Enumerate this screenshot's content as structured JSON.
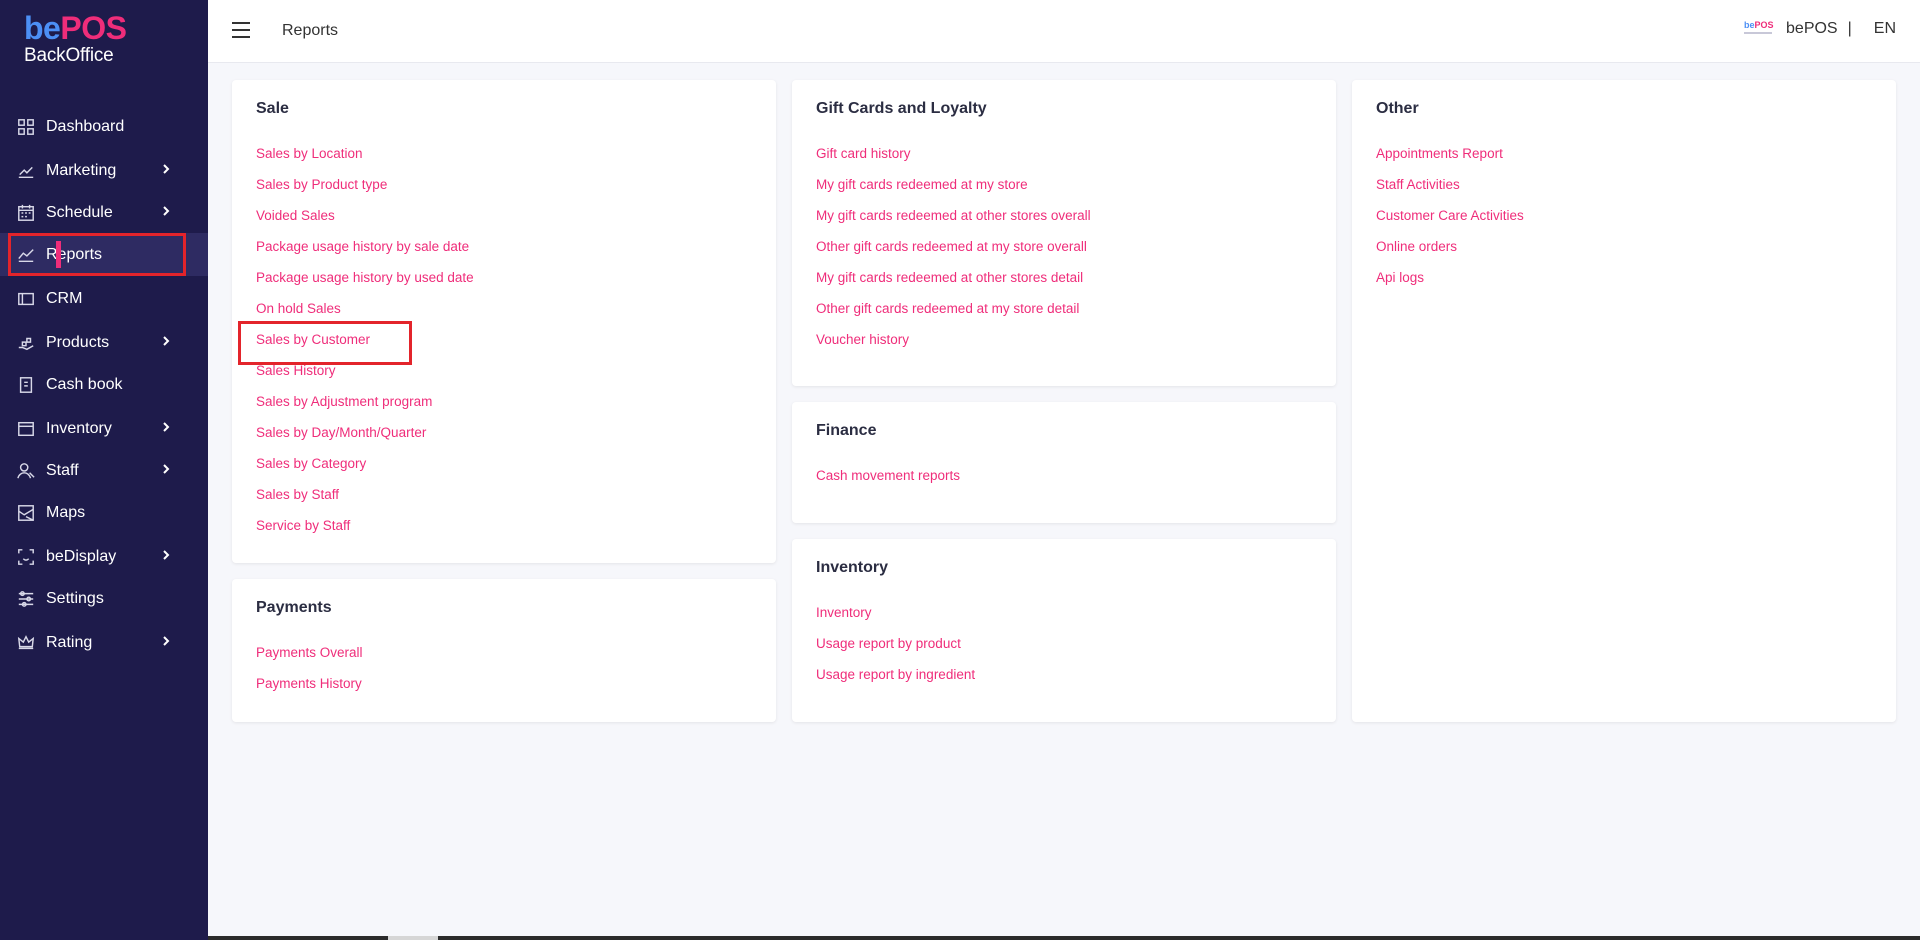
{
  "app": {
    "brand_be": "be",
    "brand_pos": "POS",
    "brand_sub": "BackOffice"
  },
  "sidebar": {
    "items": [
      {
        "label": "Dashboard",
        "icon": "dashboard-grid-icon",
        "has_chevron": false
      },
      {
        "label": "Marketing",
        "icon": "chart-line-icon",
        "has_chevron": true
      },
      {
        "label": "Schedule",
        "icon": "calendar-icon",
        "has_chevron": true
      },
      {
        "label": "Reports",
        "icon": "trend-icon",
        "has_chevron": false,
        "active": true
      },
      {
        "label": "CRM",
        "icon": "card-icon",
        "has_chevron": false
      },
      {
        "label": "Products",
        "icon": "box-hand-icon",
        "has_chevron": true
      },
      {
        "label": "Cash book",
        "icon": "book-icon",
        "has_chevron": false
      },
      {
        "label": "Inventory",
        "icon": "archive-icon",
        "has_chevron": true
      },
      {
        "label": "Staff",
        "icon": "users-icon",
        "has_chevron": true
      },
      {
        "label": "Maps",
        "icon": "map-icon",
        "has_chevron": false
      },
      {
        "label": "beDisplay",
        "icon": "face-scan-icon",
        "has_chevron": true
      },
      {
        "label": "Settings",
        "icon": "sliders-icon",
        "has_chevron": false
      },
      {
        "label": "Rating",
        "icon": "crown-icon",
        "has_chevron": true
      }
    ]
  },
  "header": {
    "title": "Reports",
    "account": "bePOS",
    "separator": "|",
    "language": "EN",
    "mini_logo_be": "be",
    "mini_logo_pos": "POS"
  },
  "cards": {
    "sale": {
      "title": "Sale",
      "links": [
        "Sales by Location",
        "Sales by Product type",
        "Voided Sales",
        "Package usage history by sale date",
        "Package usage history by used date",
        "On hold Sales",
        "Sales by Customer",
        "Sales History",
        "Sales by Adjustment program",
        "Sales by Day/Month/Quarter",
        "Sales by Category",
        "Sales by Staff",
        "Service by Staff"
      ]
    },
    "payments": {
      "title": "Payments",
      "links": [
        "Payments Overall",
        "Payments History"
      ]
    },
    "gift": {
      "title": "Gift Cards and Loyalty",
      "links": [
        "Gift card history",
        "My gift cards redeemed at my store",
        "My gift cards redeemed at other stores overall",
        "Other gift cards redeemed at my store overall",
        "My gift cards redeemed at other stores detail",
        "Other gift cards redeemed at my store detail",
        "Voucher history"
      ]
    },
    "finance": {
      "title": "Finance",
      "links": [
        "Cash movement reports"
      ]
    },
    "inventory": {
      "title": "Inventory",
      "links": [
        "Inventory",
        "Usage report by product",
        "Usage report by ingredient"
      ]
    },
    "other": {
      "title": "Other",
      "links": [
        "Appointments Report",
        "Staff Activities",
        "Customer Care Activities",
        "Online orders",
        "Api logs"
      ]
    }
  },
  "colors": {
    "sidebar_bg": "#1e1b4b",
    "accent": "#ef2d7a",
    "highlight_box": "#e3242b",
    "brand_blue": "#4c8ff5"
  }
}
